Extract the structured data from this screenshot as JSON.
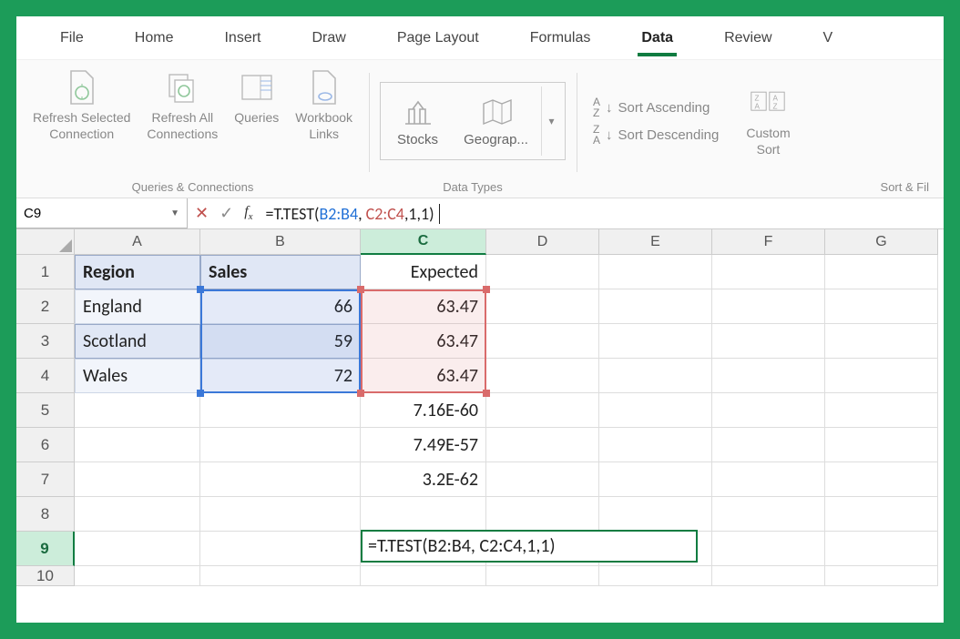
{
  "tabs": {
    "file": "File",
    "home": "Home",
    "insert": "Insert",
    "draw": "Draw",
    "page_layout": "Page Layout",
    "formulas": "Formulas",
    "data": "Data",
    "review": "Review",
    "view": "V"
  },
  "ribbon": {
    "group1_label": "Queries & Connections",
    "refresh_selected": "Refresh Selected\nConnection",
    "refresh_all": "Refresh All\nConnections",
    "queries": "Queries",
    "workbook_links": "Workbook\nLinks",
    "group2_label": "Data Types",
    "stocks": "Stocks",
    "geograp": "Geograp...",
    "sort_asc": "Sort Ascending",
    "sort_desc": "Sort Descending",
    "custom_sort": "Custom\nSort",
    "group3_label": "Sort & Fil"
  },
  "fbar": {
    "name": "C9",
    "formula_prefix": "=T.TEST(",
    "formula_range1": "B2:B4",
    "formula_sep1": ", ",
    "formula_range2": "C2:C4",
    "formula_suffix": ",1,1)"
  },
  "columns": [
    "A",
    "B",
    "C",
    "D",
    "E",
    "F",
    "G"
  ],
  "row_numbers": [
    "1",
    "2",
    "3",
    "4",
    "5",
    "6",
    "7",
    "8",
    "9",
    "10"
  ],
  "cells": {
    "A1": "Region",
    "B1": "Sales",
    "C1": "Expected",
    "A2": "England",
    "B2": "66",
    "C2": "63.47",
    "A3": "Scotland",
    "B3": "59",
    "C3": "63.47",
    "A4": "Wales",
    "B4": "72",
    "C4": "63.47",
    "C5": "7.16E-60",
    "C6": "7.49E-57",
    "C7": "3.2E-62",
    "C9": "=T.TEST(B2:B4, C2:C4,1,1)"
  }
}
